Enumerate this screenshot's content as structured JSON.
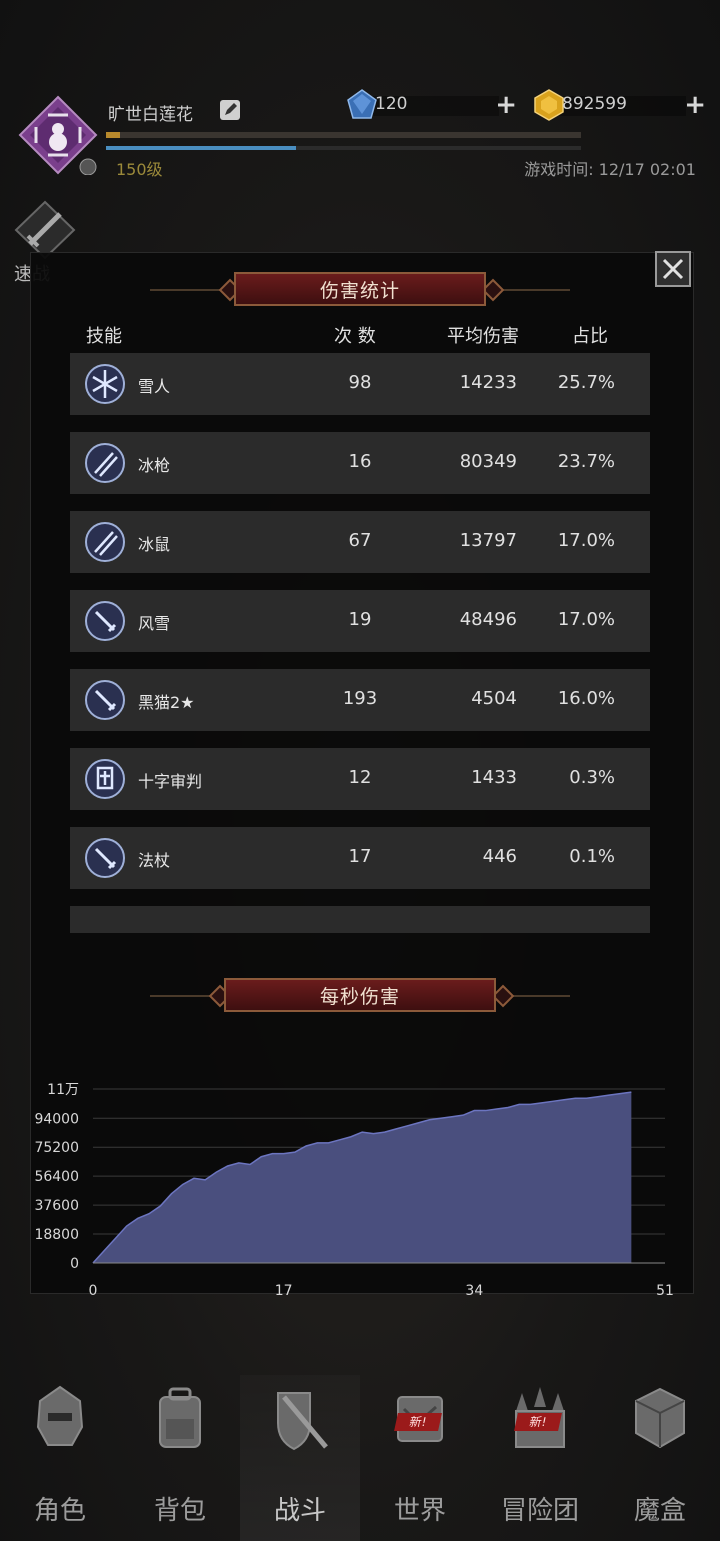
{
  "player": {
    "name": "旷世白莲花",
    "level": "150级",
    "game_time": "游戏时间: 12/17 02:01",
    "exp_fraction": 0.03,
    "hp_fraction": 0.4
  },
  "resources": {
    "diamonds": "120",
    "gold": "892599"
  },
  "speed_battle_label": "速战",
  "damage_panel": {
    "title": "伤害统计",
    "headers": {
      "skill": "技能",
      "count": "次 数",
      "avg": "平均伤害",
      "pct": "占比"
    },
    "rows": [
      {
        "icon": "snowflake-icon",
        "name": "雪人",
        "count": "98",
        "avg": "14233",
        "pct": "25.7%"
      },
      {
        "icon": "ice-spear-icon",
        "name": "冰枪",
        "count": "16",
        "avg": "80349",
        "pct": "23.7%"
      },
      {
        "icon": "ice-spear-icon",
        "name": "冰鼠",
        "count": "67",
        "avg": "13797",
        "pct": "17.0%"
      },
      {
        "icon": "sword-icon",
        "name": "风雪",
        "count": "19",
        "avg": "48496",
        "pct": "17.0%"
      },
      {
        "icon": "sword-icon",
        "name": "黑猫2★",
        "count": "193",
        "avg": "4504",
        "pct": "16.0%"
      },
      {
        "icon": "banner-icon",
        "name": "十字审判",
        "count": "12",
        "avg": "1433",
        "pct": "0.3%"
      },
      {
        "icon": "sword-icon",
        "name": "法杖",
        "count": "17",
        "avg": "446",
        "pct": "0.1%"
      }
    ]
  },
  "dps_title": "每秒伤害",
  "chart_data": {
    "type": "area",
    "title": "每秒伤害",
    "xlabel": "",
    "ylabel": "",
    "xlim": [
      0,
      51
    ],
    "ylim": [
      0,
      113000
    ],
    "x_ticks": [
      "0",
      "17",
      "34",
      "51"
    ],
    "y_ticks": [
      "0",
      "18800",
      "37600",
      "56400",
      "75200",
      "94000",
      "11万"
    ],
    "y_tick_values": [
      0,
      18800,
      37600,
      56400,
      75200,
      94000,
      113000
    ],
    "grid": true,
    "x": [
      0,
      1,
      2,
      3,
      4,
      5,
      6,
      7,
      8,
      9,
      10,
      11,
      12,
      13,
      14,
      15,
      16,
      17,
      18,
      19,
      20,
      21,
      22,
      23,
      24,
      25,
      26,
      27,
      28,
      29,
      30,
      31,
      32,
      33,
      34,
      35,
      36,
      37,
      38,
      39,
      40,
      41,
      42,
      43,
      44,
      45,
      46,
      47,
      48
    ],
    "values": [
      0,
      8000,
      16000,
      24000,
      29000,
      32000,
      37000,
      45000,
      51000,
      55000,
      54000,
      59000,
      63000,
      65000,
      64000,
      69000,
      71000,
      71000,
      72000,
      76000,
      78000,
      78000,
      80000,
      82000,
      85000,
      84000,
      85000,
      87000,
      89000,
      91000,
      93000,
      94000,
      95000,
      96000,
      99000,
      99000,
      100000,
      101000,
      103000,
      103000,
      104000,
      105000,
      106000,
      107000,
      107000,
      108000,
      109000,
      110000,
      111000
    ]
  },
  "nav": [
    {
      "label": "角色",
      "icon": "helmet-icon",
      "badge": ""
    },
    {
      "label": "背包",
      "icon": "backpack-icon",
      "badge": ""
    },
    {
      "label": "战斗",
      "icon": "shield-sword-icon",
      "badge": ""
    },
    {
      "label": "世界",
      "icon": "scroll-map-icon",
      "badge": "新!"
    },
    {
      "label": "冒险团",
      "icon": "castle-icon",
      "badge": "新!"
    },
    {
      "label": "魔盒",
      "icon": "cube-icon",
      "badge": ""
    }
  ]
}
